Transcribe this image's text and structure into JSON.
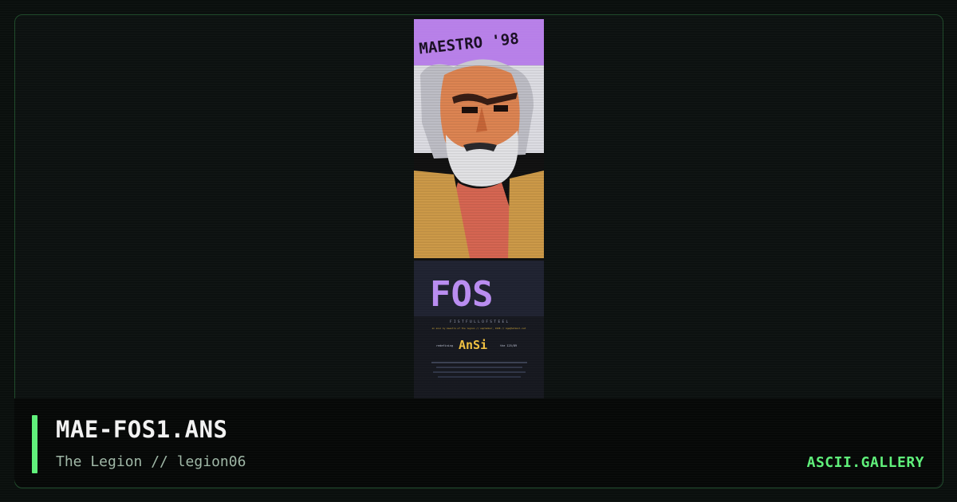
{
  "artwork": {
    "top_text": "MAESTRO '98",
    "logo_text": "FOS",
    "tagline": "F I S T F U L L   O F   S T E E L",
    "credit": "an ansi by maestro of the legion // september, 1998 // mge@hotmail.net",
    "celebrate_left": "redefining",
    "celebrate_logo": "AnSi",
    "celebrate_right": "the 125/89"
  },
  "info": {
    "title": "MAE-FOS1.ANS",
    "subtitle": "The Legion // legion06",
    "site": "ASCII.GALLERY"
  },
  "colors": {
    "accent": "#5ff07a",
    "purple": "#b98cf0",
    "skin": "#e88a55",
    "jacket": "#d6a04a"
  }
}
